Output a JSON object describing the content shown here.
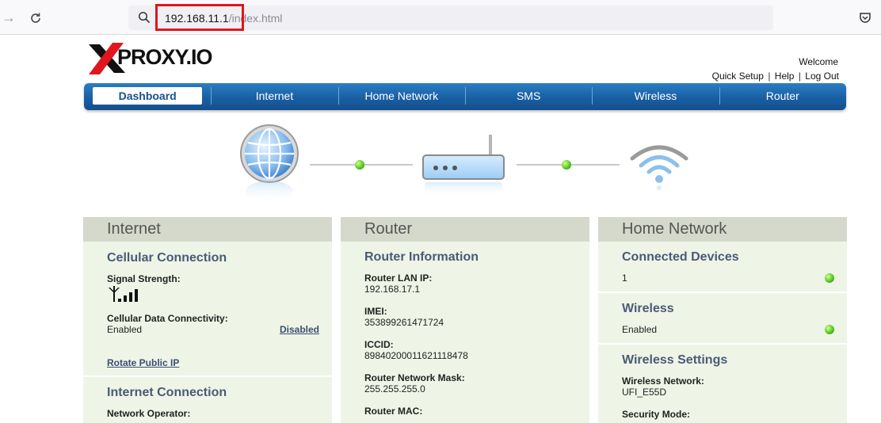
{
  "browser": {
    "url_host": "192.168.11.1",
    "url_path": "/index.html"
  },
  "logo": {
    "text": "PROXY.IO"
  },
  "header": {
    "welcome": "Welcome",
    "links": [
      "Quick Setup",
      "Help",
      "Log Out"
    ],
    "separator": "|"
  },
  "nav": {
    "tabs": [
      "Dashboard",
      "Internet",
      "Home Network",
      "SMS",
      "Wireless",
      "Router"
    ],
    "active": "Dashboard"
  },
  "internet_panel": {
    "title": "Internet",
    "cellular_title": "Cellular Connection",
    "signal_label": "Signal Strength:",
    "signal_level": 4,
    "signal_max": 4,
    "data_label": "Cellular Data Connectivity:",
    "data_value": "Enabled",
    "data_toggle": "Disabled",
    "rotate_link": "Rotate Public IP",
    "internet_conn_title": "Internet Connection",
    "operator_label": "Network Operator:"
  },
  "router_panel": {
    "title": "Router",
    "info_title": "Router Information",
    "lan_ip_label": "Router LAN IP:",
    "lan_ip": "192.168.17.1",
    "imei_label": "IMEI:",
    "imei": "353899261471724",
    "iccid_label": "ICCID:",
    "iccid": "89840200011621118478",
    "mask_label": "Router Network Mask:",
    "mask": "255.255.255.0",
    "mac_label": "Router MAC:"
  },
  "home_panel": {
    "title": "Home Network",
    "devices_title": "Connected Devices",
    "devices_count": "1",
    "wireless_title": "Wireless",
    "wireless_value": "Enabled",
    "settings_title": "Wireless Settings",
    "network_label": "Wireless Network:",
    "network_value": "UFI_E55D",
    "security_label": "Security Mode:"
  },
  "colors": {
    "nav_blue": "#1a5fa3",
    "panel_bg": "#eef5e6",
    "panel_head": "#d5d9cb",
    "section_title": "#4a5a78",
    "status_green": "#4bc21c",
    "url_highlight": "#e0161e"
  }
}
